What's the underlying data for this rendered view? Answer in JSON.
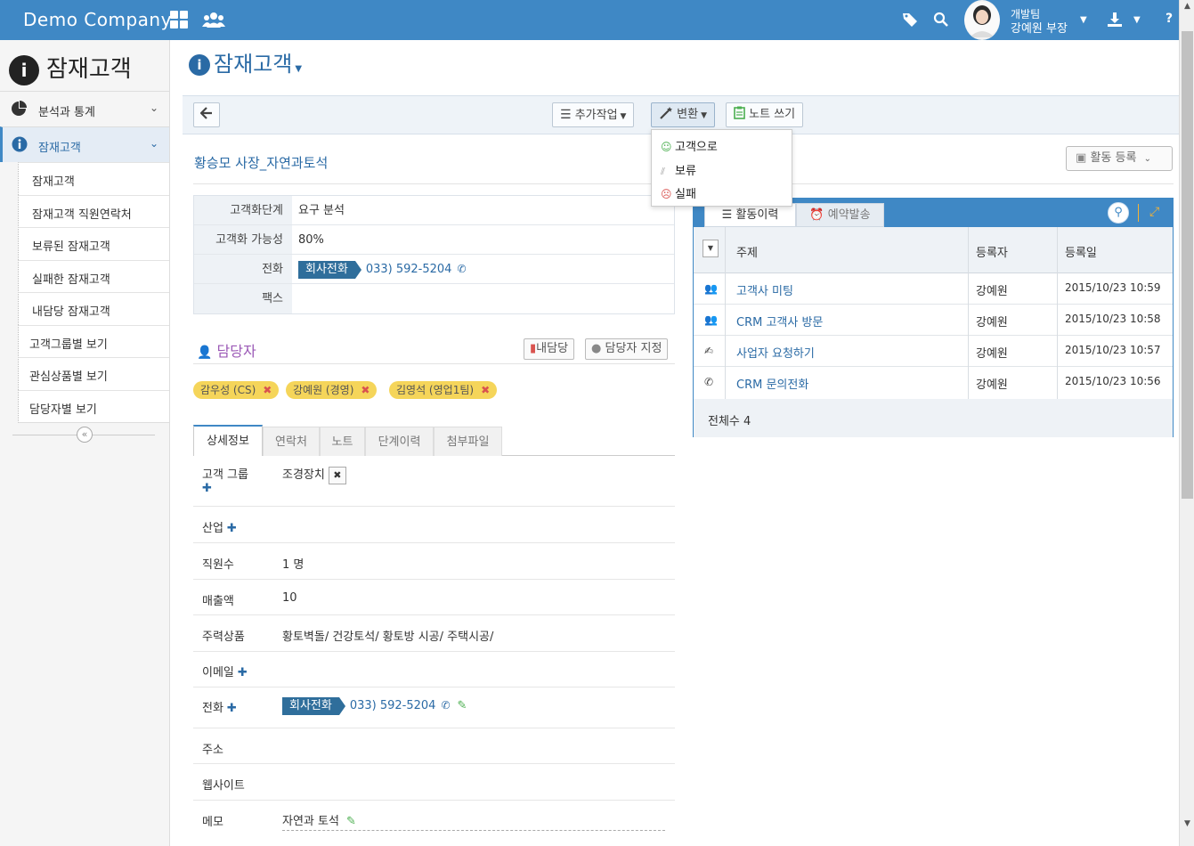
{
  "header": {
    "brand": "Demo Company",
    "user_team": "개발팀",
    "user_name": "강예원 부장"
  },
  "sidebar": {
    "title": "잠재고객",
    "sections": [
      {
        "label": "분석과 통계"
      },
      {
        "label": "잠재고객"
      }
    ],
    "items": [
      {
        "label": "잠재고객"
      },
      {
        "label": "잠재고객 직원연락처"
      },
      {
        "label": "보류된 잠재고객"
      },
      {
        "label": "실패한 잠재고객"
      },
      {
        "label": "내담당 잠재고객"
      },
      {
        "label": "고객그룹별 보기"
      },
      {
        "label": "관심상품별 보기"
      },
      {
        "label": "담당자별 보기"
      }
    ]
  },
  "main": {
    "page_title": "잠재고객",
    "toolbar": {
      "more_actions": "추가작업",
      "convert": "변환",
      "write_note": "노트 쓰기"
    },
    "convert_menu": [
      {
        "label": "고객으로"
      },
      {
        "label": "보류"
      },
      {
        "label": "실패"
      }
    ],
    "lead_name": "황승모 사장_자연과토석",
    "info": [
      {
        "key": "고객화단계",
        "value": "요구 분석"
      },
      {
        "key": "고객화 가능성",
        "value": "80%"
      },
      {
        "key": "전화",
        "tag": "회사전화",
        "value": "033) 592-5204"
      },
      {
        "key": "팩스",
        "value": ""
      }
    ],
    "managers": {
      "title": "담당자",
      "my_button": "내담당",
      "assign_button": "담당자 지정",
      "people": [
        "감우성 (CS)",
        "강예원 (경영)",
        "김영석 (영업1팀)"
      ]
    },
    "tabs": [
      "상세정보",
      "연락처",
      "노트",
      "단계이력",
      "첨부파일"
    ],
    "details": [
      {
        "key": "고객 그룹",
        "value": "조경장치"
      },
      {
        "key": "산업",
        "value": ""
      },
      {
        "key": "직원수",
        "value": "1 명"
      },
      {
        "key": "매출액",
        "value": "10"
      },
      {
        "key": "주력상품",
        "value": "황토벽돌/ 건강토석/ 황토방 시공/ 주택시공/"
      },
      {
        "key": "이메일",
        "value": ""
      },
      {
        "key": "전화",
        "tag": "회사전화",
        "value": "033) 592-5204"
      },
      {
        "key": "주소",
        "value": ""
      },
      {
        "key": "웹사이트",
        "value": ""
      },
      {
        "key": "메모",
        "value": "자연과 토석"
      }
    ]
  },
  "activity": {
    "register_button": "활동 등록",
    "tabs": [
      "활동이력",
      "예약발송"
    ],
    "columns": [
      "주제",
      "등록자",
      "등록일"
    ],
    "rows": [
      {
        "icon": "meeting-icon",
        "subject": "고객사 미팅",
        "author": "강예원",
        "date": "2015/10/23 10:59"
      },
      {
        "icon": "visit-icon",
        "subject": "CRM 고객사 방문",
        "author": "강예원",
        "date": "2015/10/23 10:58"
      },
      {
        "icon": "request-icon",
        "subject": "사업자 요청하기",
        "author": "강예원",
        "date": "2015/10/23 10:57"
      },
      {
        "icon": "phone-icon",
        "subject": "CRM 문의전화",
        "author": "강예원",
        "date": "2015/10/23 10:56"
      }
    ],
    "total": "전체수 4"
  }
}
